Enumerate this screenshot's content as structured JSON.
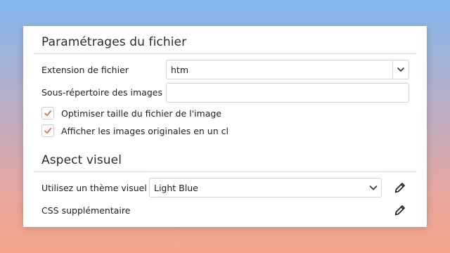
{
  "file_settings": {
    "title": "Paramétrages du fichier",
    "extension_label": "Extension de fichier",
    "extension_value": "htm",
    "subdir_label": "Sous-répertoire des images",
    "subdir_value": "",
    "optimize_label": "Optimiser taille du fichier de l'image",
    "optimize_checked": true,
    "show_original_label": "Afficher les images originales en un cl",
    "show_original_checked": true
  },
  "visual": {
    "title": "Aspect visuel",
    "theme_label": "Utilisez un thème visuel",
    "theme_value": "Light Blue",
    "css_label": "CSS supplémentaire"
  },
  "icons": {
    "checkmark": "check-icon",
    "dropdown": "chevron-down-icon",
    "edit": "pencil-icon"
  },
  "colors": {
    "check_accent": "#e0703f",
    "rule": "#cfe0e8"
  }
}
